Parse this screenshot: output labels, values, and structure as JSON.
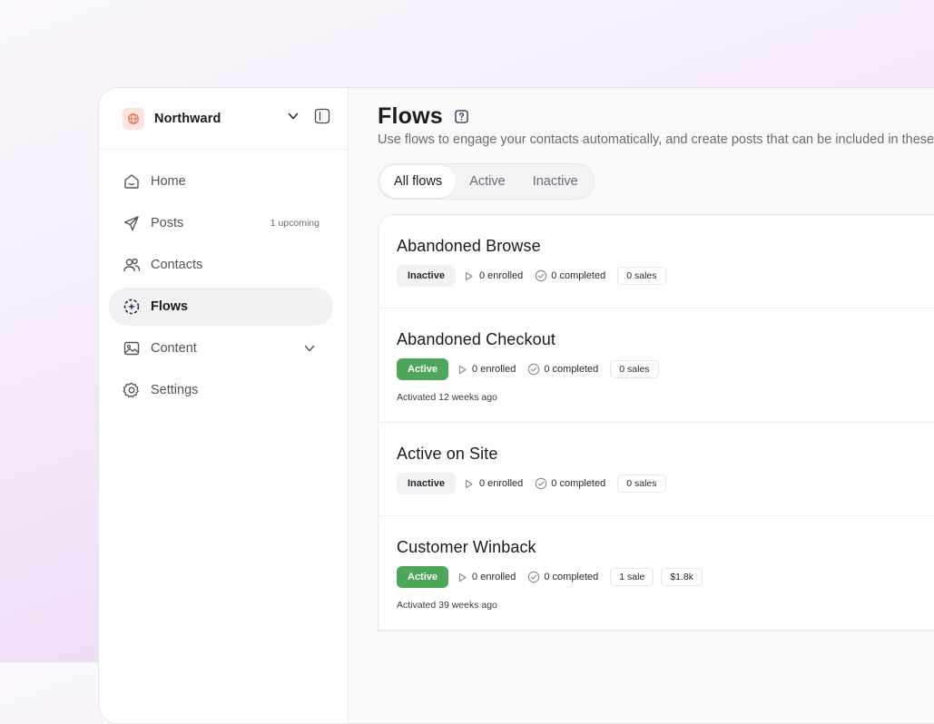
{
  "workspace": {
    "name": "Northward",
    "logo_icon": "globe-icon",
    "chevron_icon": "chevron-down-icon",
    "toggle_icon": "sidebar-toggle-icon"
  },
  "nav": {
    "items": [
      {
        "label": "Home",
        "icon": "home-icon"
      },
      {
        "label": "Posts",
        "icon": "send-icon",
        "note": "1 upcoming"
      },
      {
        "label": "Contacts",
        "icon": "users-icon"
      },
      {
        "label": "Flows",
        "icon": "flows-icon",
        "active": true
      },
      {
        "label": "Content",
        "icon": "image-icon"
      },
      {
        "label": "Settings",
        "icon": "gear-icon"
      }
    ]
  },
  "header": {
    "title": "Flows",
    "help_icon": "help-icon",
    "subtitle": "Use flows to engage your contacts automatically, and create posts that can be included in these flows."
  },
  "tabs": [
    "All flows",
    "Active",
    "Inactive"
  ],
  "active_tab": "All flows",
  "flows": [
    {
      "name": "Abandoned Browse",
      "status": "Inactive",
      "enrolled": "0 enrolled",
      "completed": "0 completed",
      "sales": [
        "0 sales"
      ],
      "activated": ""
    },
    {
      "name": "Abandoned Checkout",
      "status": "Active",
      "enrolled": "0 enrolled",
      "completed": "0 completed",
      "sales": [
        "0 sales"
      ],
      "activated": "Activated 12 weeks ago"
    },
    {
      "name": "Active on Site",
      "status": "Inactive",
      "enrolled": "0 enrolled",
      "completed": "0 completed",
      "sales": [
        "0 sales"
      ],
      "activated": ""
    },
    {
      "name": "Customer Winback",
      "status": "Active",
      "enrolled": "0 enrolled",
      "completed": "0 completed",
      "sales": [
        "1 sale",
        "$1.8k"
      ],
      "activated": "Activated 39 weeks ago"
    }
  ],
  "colors": {
    "active_badge": "#4ea65a",
    "inactive_badge": "#f2f1f4",
    "logo_accent": "#e46a55",
    "flows_accent": "#3b2a6e"
  }
}
